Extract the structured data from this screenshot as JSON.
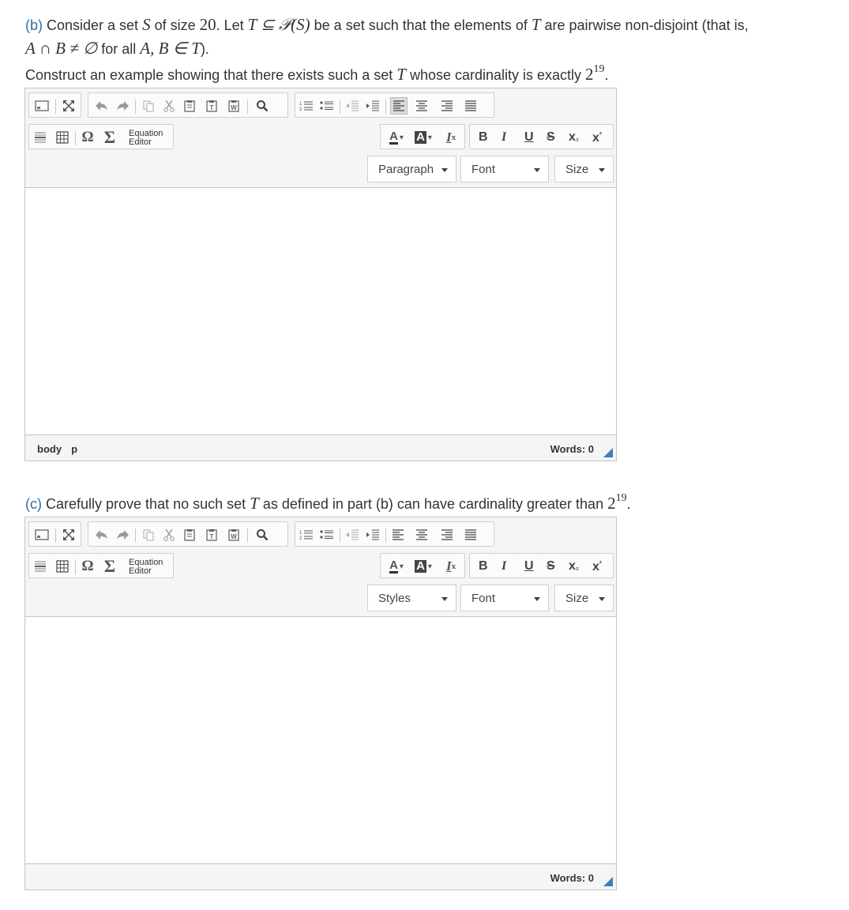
{
  "part_b": {
    "tag": "(b)",
    "line1": [
      " Consider a set ",
      "S",
      " of size ",
      "20",
      ". Let ",
      "T ⊆ 𝒫(S)",
      " be a set such that the elements of ",
      "T",
      " are pairwise non-disjoint (that is,"
    ],
    "line2": [
      "A ∩ B ≠ ∅",
      " for all ",
      "A, B ∈ T",
      ")."
    ],
    "line3": [
      "Construct an example showing that there exists such a set ",
      "T",
      " whose cardinality is exactly ",
      "2",
      "19",
      "."
    ]
  },
  "part_c": {
    "tag": "(c)",
    "line": [
      " Carefully prove that no such set ",
      "T",
      " as defined in part (b) can have cardinality greater than ",
      "2",
      "19",
      "."
    ]
  },
  "editor1": {
    "equation_label": [
      "Equation",
      "Editor"
    ],
    "format_combo": "Paragraph",
    "font_combo": "Font",
    "size_combo": "Size",
    "status_path": [
      "body",
      "p"
    ],
    "words": "Words: 0"
  },
  "editor2": {
    "equation_label": [
      "Equation",
      "Editor"
    ],
    "format_combo": "Styles",
    "font_combo": "Font",
    "size_combo": "Size",
    "words": "Words: 0"
  },
  "toolbar_icons": [
    "source-icon",
    "maximize-icon",
    "undo-icon",
    "redo-icon",
    "copy-icon",
    "cut-icon",
    "paste-icon",
    "paste-text-icon",
    "paste-word-icon",
    "find-icon",
    "numbered-list-icon",
    "bullet-list-icon",
    "outdent-icon",
    "indent-icon",
    "align-left-icon",
    "align-center-icon",
    "align-right-icon",
    "justify-icon",
    "horizontal-rule-icon",
    "table-icon",
    "special-char-icon",
    "sigma-icon"
  ],
  "format_buttons": {
    "text_color": "A",
    "bg_color": "A",
    "remove_format": "I",
    "bold": "B",
    "italic": "I",
    "underline": "U",
    "strike": "S",
    "subscript": "x",
    "superscript": "x",
    "sub_mark": "₂",
    "sup_mark": "²",
    "remove_mark": "x"
  },
  "colors": {
    "question_tag": "#2f6da3",
    "resize_handle": "#3d7ebf"
  }
}
